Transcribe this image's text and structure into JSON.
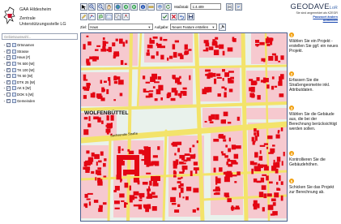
{
  "header": {
    "org_short": "GAA Hildesheim",
    "org_line1": "Zentrale",
    "org_line2": "Unterstützungsstelle LG"
  },
  "toolbar": {
    "row1_icons": [
      "select-arrow-icon",
      "zoom-in-icon",
      "zoom-out-icon",
      "pan-hand-icon",
      "zoom-full-icon",
      "zoom-previous-icon",
      "zoom-next-icon",
      "info-icon",
      "measure-icon",
      "layers-icon",
      "refresh-icon"
    ],
    "scale_label": "Maßstab:",
    "scale_value": "1:4.409",
    "row1_right_icons": [
      "print-icon",
      "export-icon"
    ],
    "row2_icons": [
      "edit-pencil-icon",
      "draw-line-icon",
      "draw-polygon-icon",
      "select-area-icon",
      "copy-icon",
      "node-icon"
    ],
    "row2_right_icons": [
      "accept-icon",
      "delete-icon",
      "undo-icon",
      "save-icon"
    ],
    "ziel_label": "Ziel:",
    "ziel_value": "Haus",
    "aufgabe_label": "Aufgabe:",
    "aufgabe_value": "Neues Feature erstellen",
    "row3_icon": "tool-icon"
  },
  "brand": {
    "name": "GEODAVE",
    "name_sub": "LoR",
    "line1": "Sie sind angemeldet als KZEGR",
    "link1": "Passwort ändern",
    "link2": "Abmelden"
  },
  "sidebar": {
    "search_placeholder": "Gebietsauswahl...",
    "layers": [
      {
        "label": "Ortsnamen",
        "checked": true
      },
      {
        "label": "Strasse",
        "checked": true
      },
      {
        "label": "Haus [#]",
        "checked": true
      },
      {
        "label": "TK 500 [W]",
        "checked": true
      },
      {
        "label": "TK 100 [W]",
        "checked": true
      },
      {
        "label": "TK 50 [W]",
        "checked": true
      },
      {
        "label": "DTK 25 [W]",
        "checked": true
      },
      {
        "label": "AK 5 [W]",
        "checked": true
      },
      {
        "label": "DOK 5 [W]",
        "checked": false
      },
      {
        "label": "Gemeinden",
        "checked": true
      }
    ]
  },
  "map": {
    "town_label": "WOLFENBÜTTEL",
    "street_label": "Sachsendie Straße",
    "colors": {
      "background": "#e9f2ec",
      "block": "#f6c9cf",
      "building": "#e30613",
      "road": "#f3e36a",
      "border": "#4a5e8e"
    }
  },
  "steps": [
    {
      "num": "1",
      "text": "Wählen Sie ein Projekt - erstellen Sie ggf. ein neues Projekt."
    },
    {
      "num": "2",
      "text": "Erfassen Sie die Straßengeometrie inkl. Attributdaten."
    },
    {
      "num": "3",
      "text": "Wählen Sie die Gebäude aus, die bei der Berechnung berücksichtigt werden sollen."
    },
    {
      "num": "4",
      "text": "Kontrollieren Sie die Gebäudehöhen."
    },
    {
      "num": "5",
      "text": "Schicken Sie das Projekt zur Berechnung ab."
    }
  ]
}
